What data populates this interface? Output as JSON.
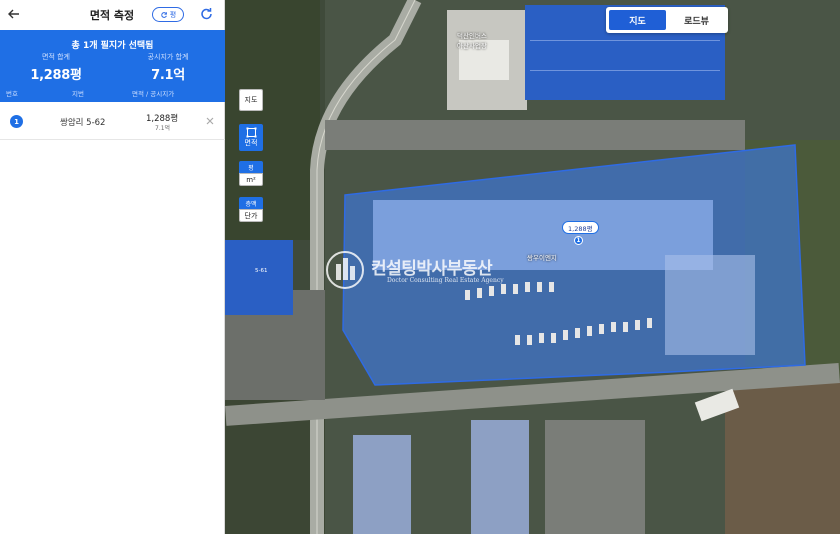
{
  "header": {
    "title": "면적 측정",
    "unit_toggle_label": "평"
  },
  "summary": {
    "title": "총 1개 필지가 선택됨",
    "area_label": "면적 합계",
    "area_value": "1,288평",
    "price_label": "공시지가 합계",
    "price_value": "7.1억"
  },
  "columns": {
    "number": "번호",
    "lot": "지번",
    "area_price": "면적 / 공시지가"
  },
  "parcels": [
    {
      "number": "1",
      "address": "쌍암리 5-62",
      "area": "1,288평",
      "price": "7.1억"
    }
  ],
  "map_type": {
    "map": "지도",
    "road_view": "로드뷰"
  },
  "tools": {
    "map_tool": "지도",
    "area_tool": "면적",
    "unit_top": "평",
    "unit_bottom": "m²",
    "height_top": "층맥",
    "height_bottom": "단가"
  },
  "map_overlay": {
    "area_badge": "1,288평",
    "pin_number": "1",
    "poi_top": "덕산인버스\n아산사업장",
    "poi_mid": "쌍우이엔지",
    "parcel_side": "5-61",
    "watermark_title": "컨설팅박사부동산",
    "watermark_sub": "Doctor Consulting Real Estate Agency"
  },
  "colors": {
    "accent": "#1f6fe5",
    "parcel_fill": "#3b7be8",
    "map_active": "#1f5fd6"
  },
  "icons": [
    "back-arrow-icon",
    "refresh-icon",
    "reset-icon",
    "close-icon",
    "area-select-icon",
    "map-pin-icon"
  ]
}
